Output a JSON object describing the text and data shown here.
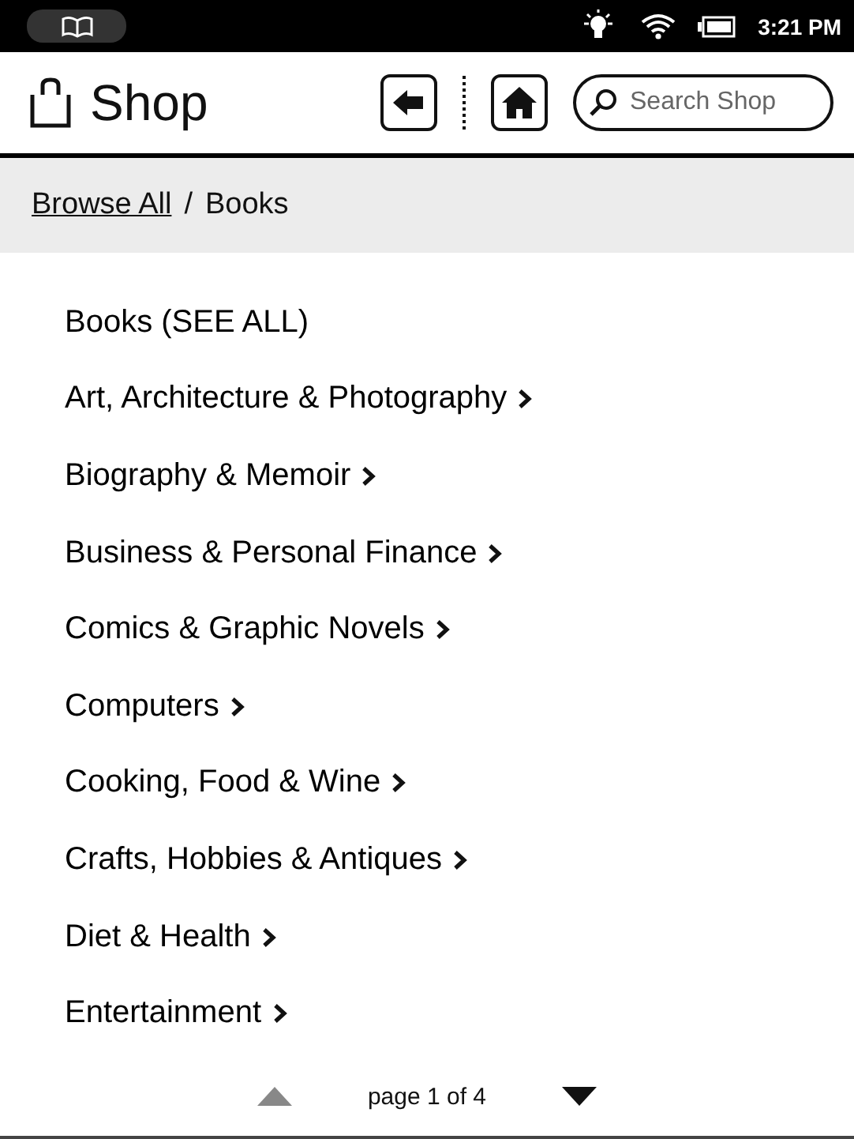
{
  "status_bar": {
    "time": "3:21 PM"
  },
  "header": {
    "title": "Shop",
    "search": {
      "placeholder": "Search Shop"
    }
  },
  "breadcrumb": [
    {
      "label": "Browse All",
      "link": true
    },
    {
      "label": "Books",
      "link": false
    }
  ],
  "breadcrumb_separator": "/",
  "categories": [
    {
      "label": "Books (SEE ALL)",
      "has_submenu": false
    },
    {
      "label": "Art, Architecture & Photography",
      "has_submenu": true
    },
    {
      "label": "Biography & Memoir",
      "has_submenu": true
    },
    {
      "label": "Business & Personal Finance",
      "has_submenu": true
    },
    {
      "label": "Comics & Graphic Novels",
      "has_submenu": true
    },
    {
      "label": "Computers",
      "has_submenu": true
    },
    {
      "label": "Cooking, Food & Wine",
      "has_submenu": true
    },
    {
      "label": "Crafts, Hobbies & Antiques",
      "has_submenu": true
    },
    {
      "label": "Diet & Health",
      "has_submenu": true
    },
    {
      "label": "Entertainment",
      "has_submenu": true
    }
  ],
  "pager": {
    "label": "page 1 of 4",
    "prev_disabled": true,
    "next_disabled": false
  }
}
